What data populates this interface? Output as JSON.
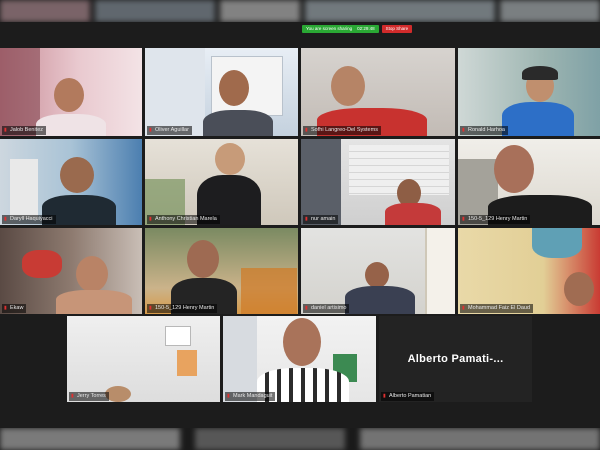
{
  "share_bar": {
    "status_text": "You are screen sharing",
    "timer": "02:29:48",
    "stop_label": "Stop Share"
  },
  "participants": [
    {
      "name": "Jalob Benitez"
    },
    {
      "name": "Oliver Aguillar"
    },
    {
      "name": "Sofhi Langreo-Del Systems"
    },
    {
      "name": "Ronald Harhoa"
    },
    {
      "name": "Daryll Haquiyacci"
    },
    {
      "name": "Anthony Christian Marela"
    },
    {
      "name": "nur amain"
    },
    {
      "name": "150-5_129 Henry Martin"
    },
    {
      "name": "Ekaw"
    },
    {
      "name": "150-5_129 Henry Martin"
    },
    {
      "name": "daniel artisimo"
    },
    {
      "name": "Mohammad Faiz El Daud"
    },
    {
      "name": "Jerry Torres"
    },
    {
      "name": "Mark Mandaguit"
    },
    {
      "name": "Alberto Pamatian"
    }
  ],
  "camera_off_display": "Alberto  Pamati-...",
  "colors": {
    "active_speaker": "#6fd36f",
    "muted_mic": "#e03030",
    "share_green": "#2aa834",
    "stop_red": "#d12b2b"
  }
}
